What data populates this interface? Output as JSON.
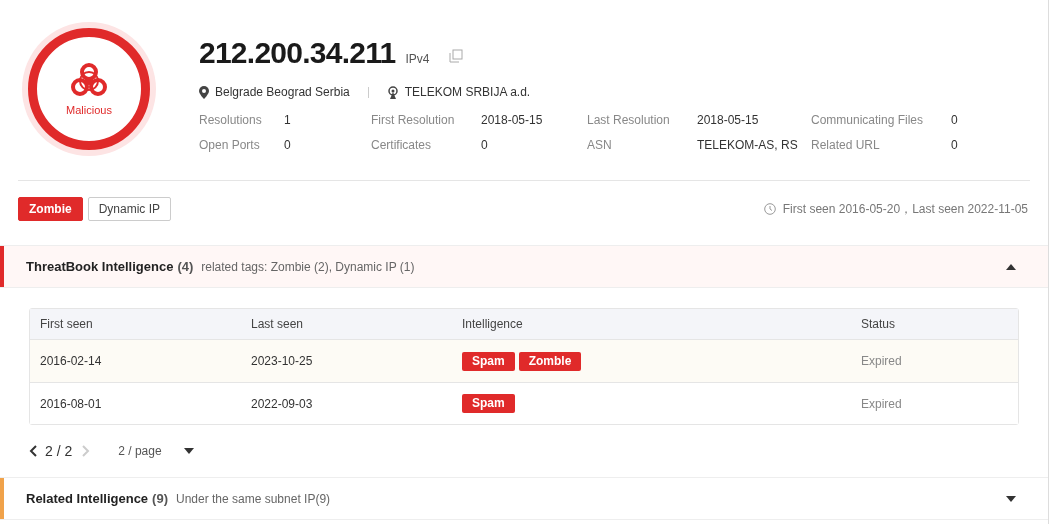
{
  "verdict": {
    "label": "Malicious"
  },
  "ip": {
    "address": "212.200.34.211",
    "version": "IPv4"
  },
  "location": "Belgrade Beograd Serbia",
  "isp": "TELEKOM SRBIJA a.d.",
  "stats": [
    [
      {
        "label": "Resolutions",
        "value": "1"
      },
      {
        "label": "First Resolution",
        "value": "2018-05-15"
      },
      {
        "label": "Last Resolution",
        "value": "2018-05-15"
      },
      {
        "label": "Communicating Files",
        "value": "0"
      }
    ],
    [
      {
        "label": "Open Ports",
        "value": "0"
      },
      {
        "label": "Certificates",
        "value": "0"
      },
      {
        "label": "ASN",
        "value": "TELEKOM-AS, RS"
      },
      {
        "label": "Related URL",
        "value": "0"
      }
    ]
  ],
  "tags": [
    {
      "label": "Zombie",
      "kind": "threat"
    },
    {
      "label": "Dynamic IP",
      "kind": "info"
    }
  ],
  "seen": "First seen 2016-05-20，Last seen 2022-11-05",
  "sections": [
    {
      "title": "ThreatBook Intelligence",
      "count": "(4)",
      "subtitle": "related tags: Zombie (2), Dynamic IP (1)",
      "expanded": true,
      "color": "#e02a2a",
      "table": {
        "columns": [
          "First seen",
          "Last seen",
          "Intelligence",
          "Status"
        ],
        "rows": [
          {
            "first_seen": "2016-02-14",
            "last_seen": "2023-10-25",
            "intelligence": [
              "Spam",
              "Zomble"
            ],
            "status": "Expired",
            "selected": true
          },
          {
            "first_seen": "2016-08-01",
            "last_seen": "2022-09-03",
            "intelligence": [
              "Spam"
            ],
            "status": "Expired",
            "selected": false
          }
        ]
      },
      "pagination": {
        "page": "2 / 2",
        "page_size": "2 / page"
      }
    },
    {
      "title": "Related Intelligence",
      "count": "(9)",
      "subtitle": "Under the same subnet IP(9)",
      "expanded": false,
      "color": "#f0a24a"
    }
  ]
}
